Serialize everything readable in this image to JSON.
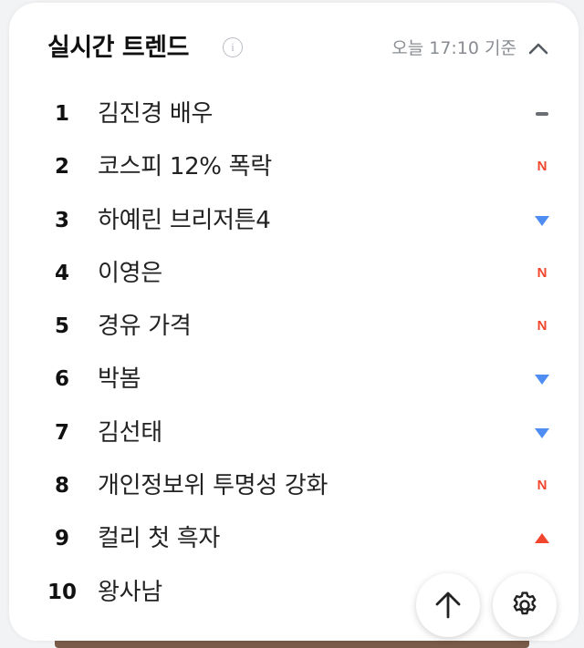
{
  "header": {
    "title": "실시간 트렌드",
    "info_icon": "i",
    "timestamp": "오늘 17:10 기준"
  },
  "trends": [
    {
      "rank": "1",
      "keyword": "김진경 배우",
      "status": "same"
    },
    {
      "rank": "2",
      "keyword": "코스피 12% 폭락",
      "status": "new",
      "status_label": "N"
    },
    {
      "rank": "3",
      "keyword": "하예린 브리저튼4",
      "status": "down"
    },
    {
      "rank": "4",
      "keyword": "이영은",
      "status": "new",
      "status_label": "N"
    },
    {
      "rank": "5",
      "keyword": "경유 가격",
      "status": "new",
      "status_label": "N"
    },
    {
      "rank": "6",
      "keyword": "박봄",
      "status": "down"
    },
    {
      "rank": "7",
      "keyword": "김선태",
      "status": "down"
    },
    {
      "rank": "8",
      "keyword": "개인정보위 투명성 강화",
      "status": "new",
      "status_label": "N"
    },
    {
      "rank": "9",
      "keyword": "컬리 첫 흑자",
      "status": "up"
    },
    {
      "rank": "10",
      "keyword": "왕사남",
      "status": "none"
    }
  ],
  "colors": {
    "new": "#f1452d",
    "up": "#f1452d",
    "down": "#4f8df2",
    "same": "#6b6f75"
  },
  "icons": {
    "collapse": "chevron-up-icon",
    "scroll_top": "arrow-up-icon",
    "settings": "gear-icon"
  }
}
